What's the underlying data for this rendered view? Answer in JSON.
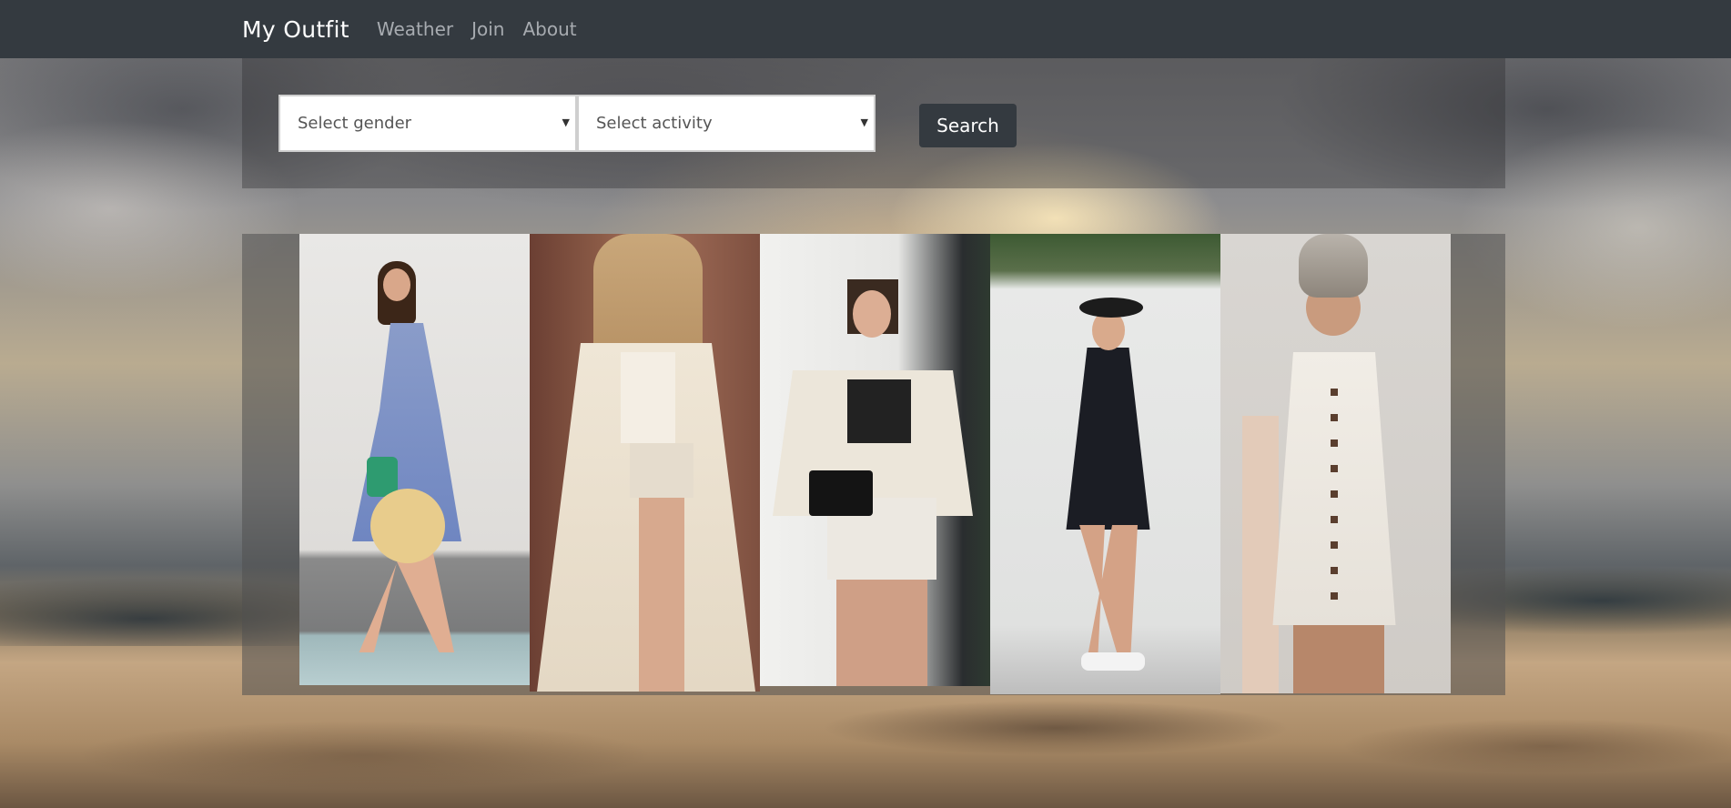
{
  "navbar": {
    "brand": "My Outfit",
    "links": [
      "Weather",
      "Join",
      "About"
    ]
  },
  "search": {
    "gender_placeholder": "Select gender",
    "activity_placeholder": "Select activity",
    "button_label": "Search"
  },
  "gallery": {
    "photos": [
      {
        "description_icon": "outfit-photo"
      },
      {
        "description_icon": "outfit-photo"
      },
      {
        "description_icon": "outfit-photo"
      },
      {
        "description_icon": "outfit-photo"
      },
      {
        "description_icon": "outfit-photo"
      }
    ]
  },
  "colors": {
    "navbar_bg": "#343a40",
    "nav_link": "#a7abb0",
    "brand": "#ffffff",
    "button_bg": "#343a40"
  }
}
